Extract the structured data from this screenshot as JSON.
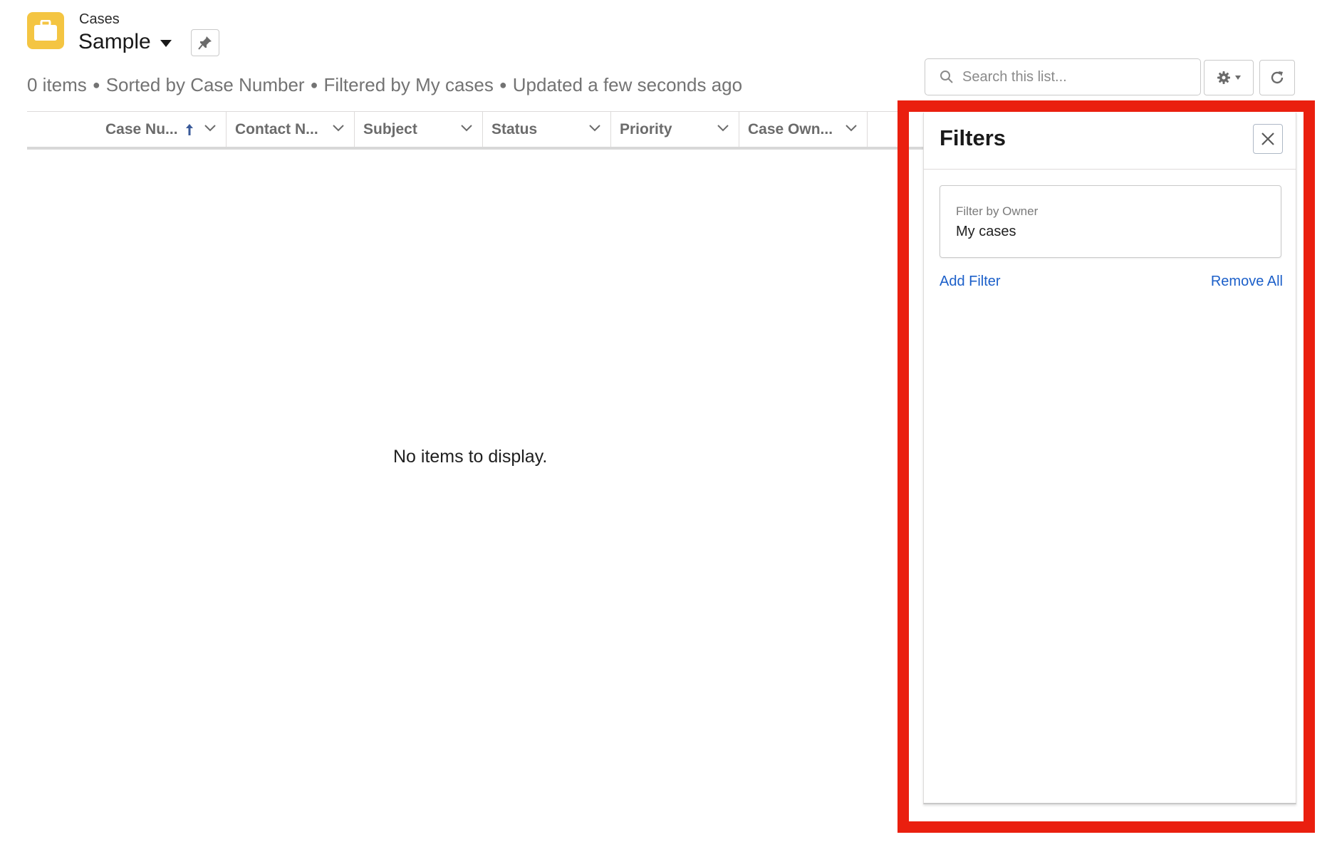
{
  "header": {
    "object_label": "Cases",
    "list_view_name": "Sample",
    "info": {
      "items": "0 items",
      "sorted": "Sorted by Case Number",
      "filtered": "Filtered by My cases",
      "updated": "Updated a few seconds ago"
    }
  },
  "toolbar": {
    "search_placeholder": "Search this list..."
  },
  "table": {
    "columns": [
      "Case Nu...",
      "Contact N...",
      "Subject",
      "Status",
      "Priority",
      "Case Own..."
    ],
    "empty_message": "No items to display."
  },
  "filters_panel": {
    "title": "Filters",
    "filter": {
      "label": "Filter by Owner",
      "value": "My cases"
    },
    "add_filter": "Add Filter",
    "remove_all": "Remove All"
  },
  "colors": {
    "app_icon": "#f4c542",
    "highlight": "#ea1f0f",
    "link": "#1b5fc9"
  }
}
